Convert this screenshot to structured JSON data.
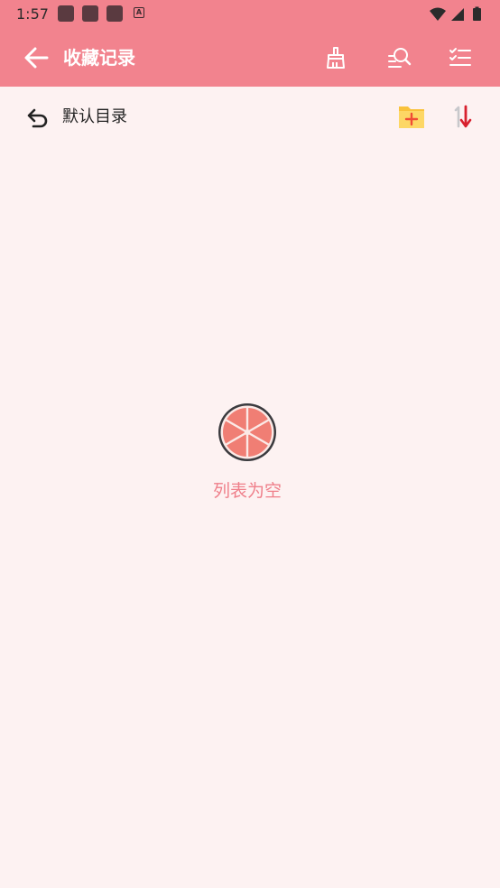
{
  "status_bar": {
    "time": "1:57",
    "notification_badge": "A"
  },
  "app_bar": {
    "title": "收藏记录",
    "icons": [
      "back-arrow-icon",
      "broom-icon",
      "search-list-icon",
      "checklist-icon"
    ]
  },
  "folder_row": {
    "current_folder": "默认目录",
    "icons": [
      "undo-icon",
      "add-folder-icon",
      "sort-icon"
    ]
  },
  "empty_state": {
    "message": "列表为空",
    "icon": "grapefruit-icon"
  },
  "colors": {
    "primary": "#f2838e",
    "background": "#fdf2f2",
    "accent_text": "#ef7f8a",
    "folder_yellow": "#fcd053",
    "folder_plus": "#f04b36",
    "sort_red": "#d8202e"
  }
}
